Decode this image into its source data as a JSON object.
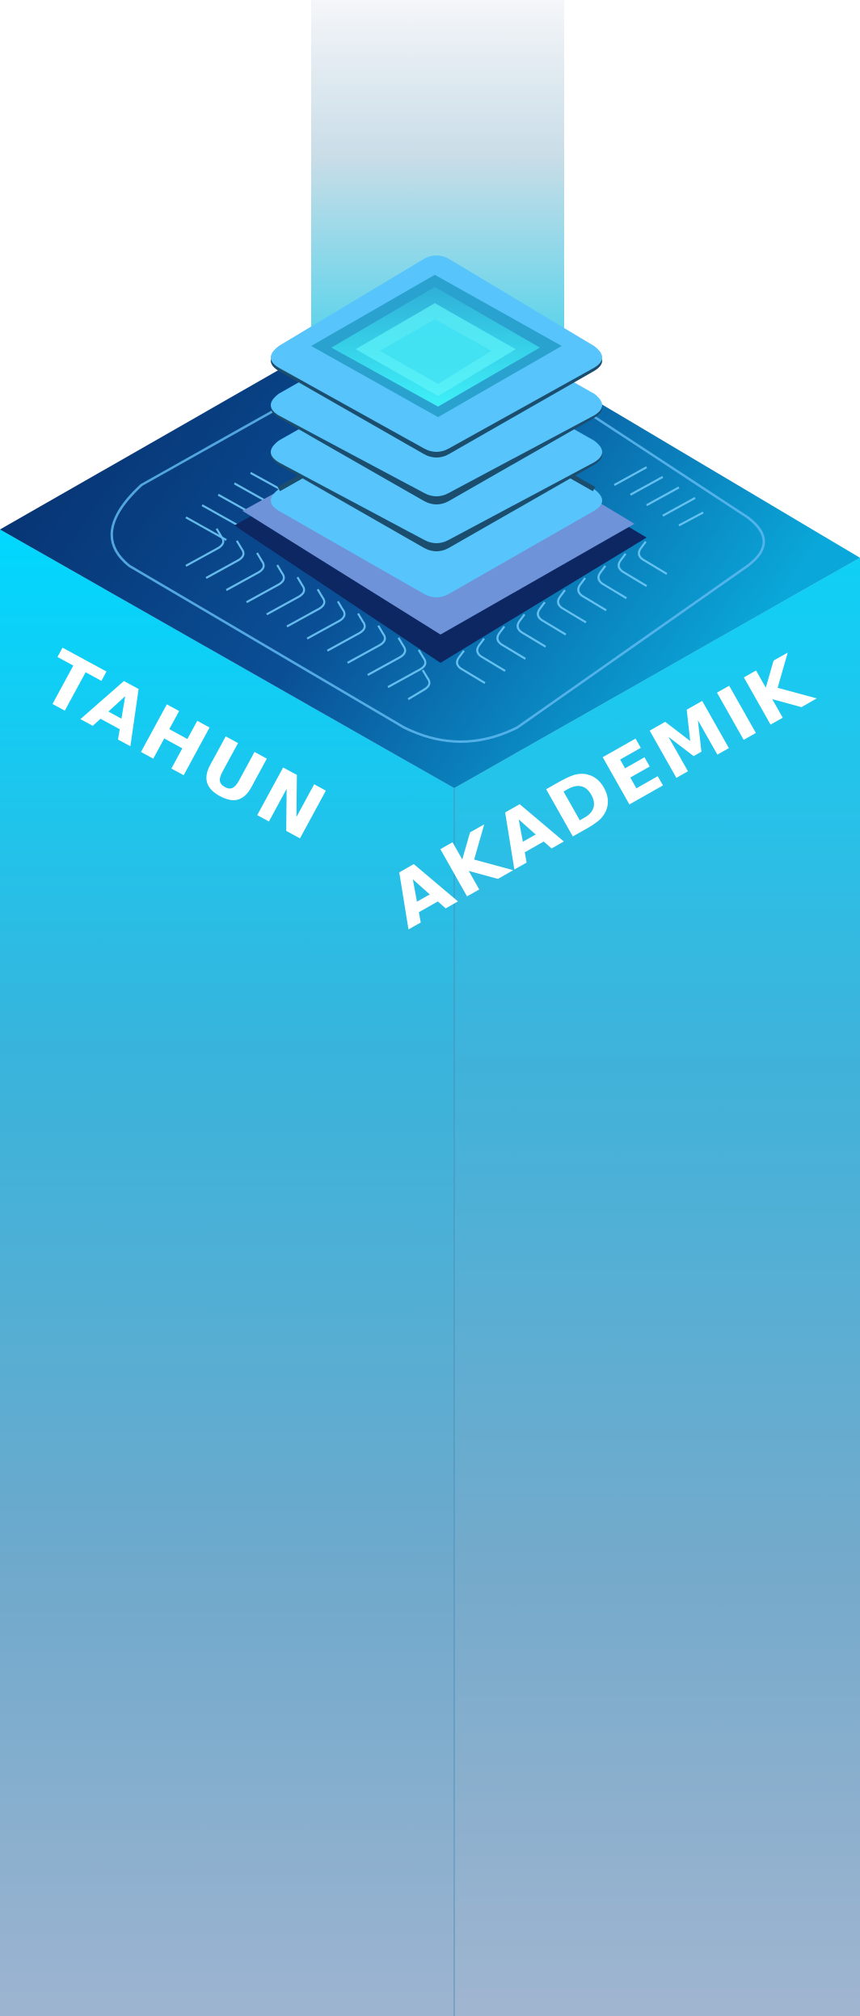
{
  "label": {
    "word_left": "TAHUN",
    "word_right": "AKADEMIK"
  },
  "colors": {
    "top_face": "#0a3a7a",
    "left_face_top": "#00d2fb",
    "left_face_bottom": "#9ab4d0",
    "right_face_top": "#1fc8f0",
    "right_face_bottom": "#9fb4d0",
    "chip_light": "#57c4fb",
    "chip_dark": "#1b4d6e",
    "chip_base": "#6e93d8",
    "beam_top": "#f2f4f8",
    "beam_bottom": "#5fd4ec",
    "text": "#ffffff"
  },
  "icons": {
    "chip": "processor-chip-icon"
  }
}
